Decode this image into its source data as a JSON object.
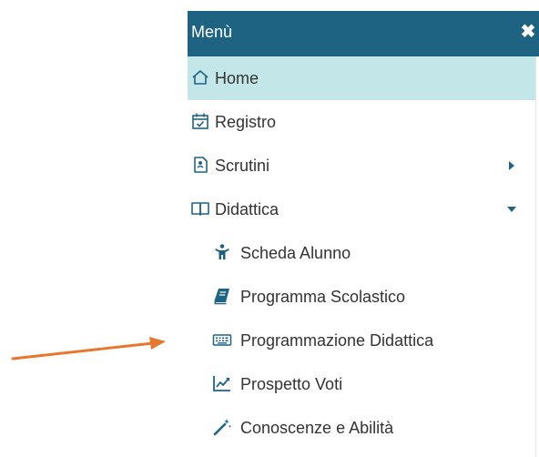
{
  "menu": {
    "title": "Menù",
    "close_icon": "close-icon",
    "items": [
      {
        "label": "Home",
        "icon": "home-icon",
        "active": true
      },
      {
        "label": "Registro",
        "icon": "calendar-check-icon"
      },
      {
        "label": "Scrutini",
        "icon": "scrutini-icon",
        "caret": "right"
      },
      {
        "label": "Didattica",
        "icon": "book-open-icon",
        "caret": "down",
        "expanded": true
      },
      {
        "label": "Scheda Alunno",
        "icon": "child-icon"
      },
      {
        "label": "Programma Scolastico",
        "icon": "book-icon"
      },
      {
        "label": "Programmazione Didattica",
        "icon": "keyboard-icon"
      },
      {
        "label": "Prospetto Voti",
        "icon": "line-chart-icon"
      },
      {
        "label": "Conoscenze e Abilità",
        "icon": "magic-wand-icon"
      }
    ]
  },
  "colors": {
    "header_bg": "#1f6383",
    "active_bg": "#c3e6e8",
    "icon": "#1f6383",
    "annotation_arrow": "#e8772e"
  }
}
